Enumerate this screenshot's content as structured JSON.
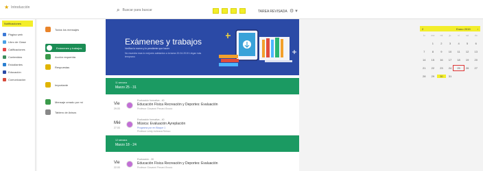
{
  "topbar": {
    "brand": "Introducción",
    "search_placeholder": "Buscar para buscar",
    "tarea_label": "TAREA REVISADA",
    "gear_label": "⚙ ▾"
  },
  "sidebar": {
    "active_label": "Notificaciones",
    "items": [
      {
        "label": "Página web",
        "color": "#3c79d6"
      },
      {
        "label": "Libro de Clase",
        "color": "#4aa0e6"
      },
      {
        "label": "Calificaciones",
        "color": "#e54848"
      },
      {
        "label": "Contenidos",
        "color": "#3c8c5c"
      },
      {
        "label": "Estudiantes",
        "color": "#2b7fd1"
      },
      {
        "label": "Educación",
        "color": "#2b4aa6"
      },
      {
        "label": "Comunicación",
        "color": "#d64a3b"
      }
    ]
  },
  "col2": {
    "items": [
      {
        "label": "Todos los mensajes",
        "color": "#e9842a",
        "active": false
      },
      {
        "label": "Exámenes y trabajos",
        "color": "#fff",
        "active": true
      },
      {
        "label": "Acción requerida",
        "color": "#3a9a4a",
        "active": false
      },
      {
        "label": "Respuestas",
        "color": "#e0b400",
        "active": false
      },
      {
        "label": "Importante",
        "color": "#e0b400",
        "active": false
      },
      {
        "label": "Mensaje creado por mí",
        "color": "#3a9a4a",
        "active": false
      },
      {
        "label": "Tablero de Avisos",
        "color": "#888",
        "active": false
      }
    ]
  },
  "hero": {
    "title": "Exámenes y trabajos",
    "subtitle": "Verifica lo nuevo y lo pendiente que hacer",
    "description": "No muestra mas lo mejores adelantos a la tarea 20.04.2019 Llegar más temprano"
  },
  "weeks": [
    {
      "number": "11 semana",
      "dates": "Marzo 25 - 31"
    },
    {
      "number": "12 semana",
      "dates": "Marzo 18 - 24"
    }
  ],
  "events": [
    {
      "day": "Vie",
      "date": "29.03",
      "type": "Evaluación formativa - 40",
      "title": "Educación Física Recreación y Deportes: Evaluación",
      "meta": "Profesor Giovanni Penaró Brocío",
      "meta2": ""
    },
    {
      "day": "Mié",
      "date": "27.03",
      "type": "Evaluación formativa - 40",
      "title": "Música: Evaluación Ayreplación",
      "meta": "Programa por en Bloque 1",
      "meta2": "Profesor Leidy Julieana Reinco"
    },
    {
      "day": "Vie",
      "date": "22.03",
      "type": "Evaluación - 30",
      "title": "Educación Física Recreación y Deportes: Evaluación",
      "meta": "Profesor Giovanni Penaró Brocío",
      "meta2": ""
    }
  ],
  "calendar": {
    "left_label": "2",
    "month": "Enero 2019",
    "weekday_headers": [
      "lu",
      "ma",
      "mi",
      "ju",
      "vi",
      "sá",
      "do"
    ],
    "days": [
      "",
      "1",
      "2",
      "3",
      "4",
      "5",
      "6",
      "7",
      "8",
      "9",
      "10",
      "11",
      "12",
      "13",
      "14",
      "15",
      "16",
      "17",
      "18",
      "19",
      "20",
      "21",
      "22",
      "23",
      "24",
      "25",
      "26",
      "27",
      "28",
      "29",
      "30",
      "31",
      "",
      "",
      ""
    ],
    "today": "25",
    "highlight": "30"
  }
}
